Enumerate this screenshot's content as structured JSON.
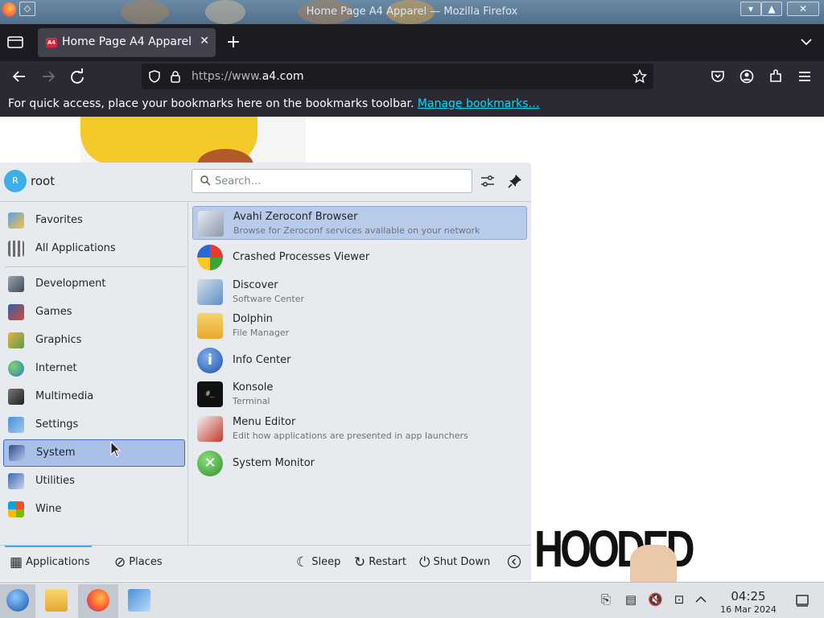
{
  "window": {
    "title": "Home Page A4 Apparel — Mozilla Firefox",
    "buttons": [
      "▾",
      "▲",
      "✕"
    ]
  },
  "tab": {
    "favicon_text": "A4",
    "title": "Home Page A4 Apparel",
    "close": "✕",
    "new_tab": "+"
  },
  "nav": {
    "url_prefix": "https://www.",
    "url_domain": "a4.com"
  },
  "bookmarks": {
    "message": "For quick access, place your bookmarks here on the bookmarks toolbar.",
    "link": "Manage bookmarks…"
  },
  "page": {
    "headline": "HOODED TEES"
  },
  "launcher": {
    "user": {
      "initial": "R",
      "name": "root"
    },
    "search_placeholder": "Search…",
    "categories": [
      {
        "label": "Favorites",
        "icon": "favorites-icon"
      },
      {
        "label": "All Applications",
        "icon": "all-applications-icon"
      },
      {
        "label": "Development",
        "icon": "development-icon"
      },
      {
        "label": "Games",
        "icon": "games-icon"
      },
      {
        "label": "Graphics",
        "icon": "graphics-icon"
      },
      {
        "label": "Internet",
        "icon": "internet-icon"
      },
      {
        "label": "Multimedia",
        "icon": "multimedia-icon"
      },
      {
        "label": "Settings",
        "icon": "settings-icon"
      },
      {
        "label": "System",
        "icon": "system-icon",
        "selected": true
      },
      {
        "label": "Utilities",
        "icon": "utilities-icon"
      },
      {
        "label": "Wine",
        "icon": "wine-icon"
      }
    ],
    "apps": [
      {
        "name": "Avahi Zeroconf Browser",
        "desc": "Browse for Zeroconf services available on your network",
        "icon": "avahi-icon",
        "selected": true
      },
      {
        "name": "Crashed Processes Viewer",
        "desc": "",
        "icon": "crash-viewer-icon"
      },
      {
        "name": "Discover",
        "desc": "Software Center",
        "icon": "discover-icon"
      },
      {
        "name": "Dolphin",
        "desc": "File Manager",
        "icon": "dolphin-icon"
      },
      {
        "name": "Info Center",
        "desc": "",
        "icon": "info-center-icon"
      },
      {
        "name": "Konsole",
        "desc": "Terminal",
        "icon": "konsole-icon"
      },
      {
        "name": "Menu Editor",
        "desc": "Edit how applications are presented in app launchers",
        "icon": "menu-editor-icon"
      },
      {
        "name": "System Monitor",
        "desc": "",
        "icon": "system-monitor-icon"
      }
    ],
    "footer": {
      "applications": "Applications",
      "places": "Places",
      "sleep": "Sleep",
      "restart": "Restart",
      "shutdown": "Shut Down"
    }
  },
  "taskbar": {
    "time": "04:25",
    "date": "16 Mar 2024"
  },
  "colors": {
    "accent": "#3daee9",
    "selection": "#aac0e8",
    "firefox_dark": "#1c1b22"
  }
}
